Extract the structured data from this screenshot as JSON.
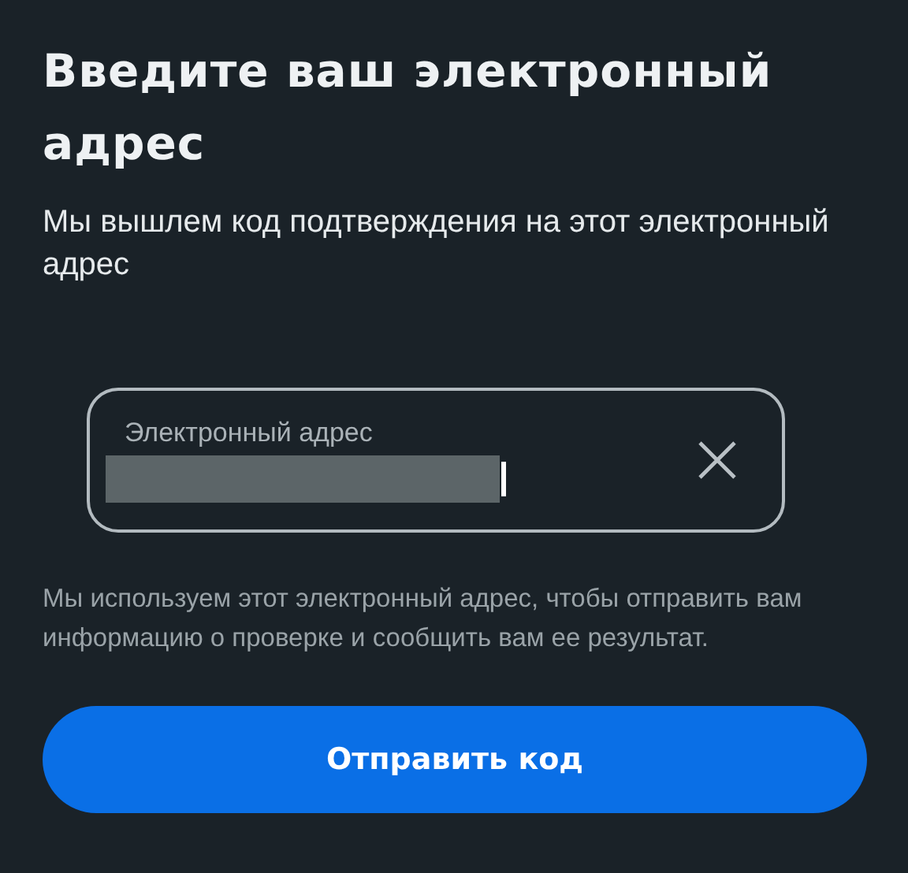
{
  "title": "Введите ваш электронный адрес",
  "subtitle": "Мы вышлем код подтверждения на этот электронный адрес",
  "email_field": {
    "label": "Электронный адрес",
    "redacted": true,
    "focused": true
  },
  "note": "Мы используем этот электронный адрес, чтобы отправить вам информацию о проверке и сообщить вам ее результат.",
  "submit_button": {
    "label": "Отправить код"
  }
}
